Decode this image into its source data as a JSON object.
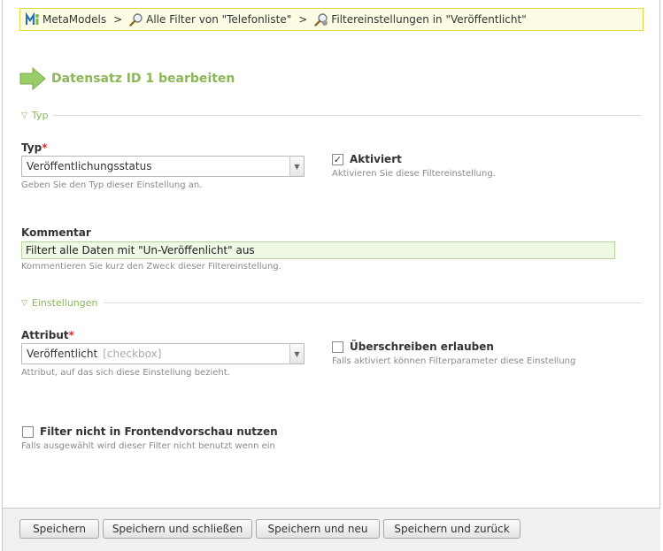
{
  "breadcrumb": {
    "items": [
      {
        "label": "MetaModels"
      },
      {
        "label": "Alle Filter von \"Telefonliste\""
      },
      {
        "label": "Filtereinstellungen in \"Veröffentlicht\""
      }
    ],
    "separator": ">"
  },
  "heading": {
    "title": "Datensatz ID 1 bearbeiten"
  },
  "sections": {
    "typ": {
      "legend": "Typ"
    },
    "einstellungen": {
      "legend": "Einstellungen"
    }
  },
  "fields": {
    "typ": {
      "label": "Typ",
      "required_mark": "*",
      "value": "Veröffentlichungsstatus",
      "help": "Geben Sie den Typ dieser Einstellung an."
    },
    "aktiviert": {
      "label": "Aktiviert",
      "checked": true,
      "check_glyph": "✓",
      "help": "Aktivieren Sie diese Filtereinstellung."
    },
    "kommentar": {
      "label": "Kommentar",
      "value": "Filtert alle Daten mit \"Un-Veröffenlicht\" aus",
      "help": "Kommentieren Sie kurz den Zweck dieser Filtereinstellung."
    },
    "attribut": {
      "label": "Attribut",
      "required_mark": "*",
      "value": "Veröffentlicht",
      "value_hint": "[checkbox]",
      "help": "Attribut, auf das sich diese Einstellung bezieht."
    },
    "ueberschreiben": {
      "label": "Überschreiben erlauben",
      "checked": false,
      "help": "Falls aktiviert können Filterparameter diese Einstellung"
    },
    "frontend": {
      "label": "Filter nicht in Frontendvorschau nutzen",
      "checked": false,
      "help": "Falls ausgewählt wird dieser Filter nicht benutzt wenn ein"
    }
  },
  "buttons": {
    "save": "Speichern",
    "save_close": "Speichern und schließen",
    "save_new": "Speichern und neu",
    "save_back": "Speichern und zurück"
  },
  "colors": {
    "accent": "#8ab858",
    "breadcrumb_bg": "#fdfde6",
    "breadcrumb_border": "#e3d84a",
    "input_bg": "#eef8e4",
    "required": "#cc3333"
  },
  "icons": {
    "breadcrumb_root": "metamodels-icon",
    "breadcrumb_filter": "magnifier-icon",
    "breadcrumb_settings": "magnifier-settings-icon",
    "heading": "green-arrow-icon",
    "legend": "triangle-down-icon"
  }
}
